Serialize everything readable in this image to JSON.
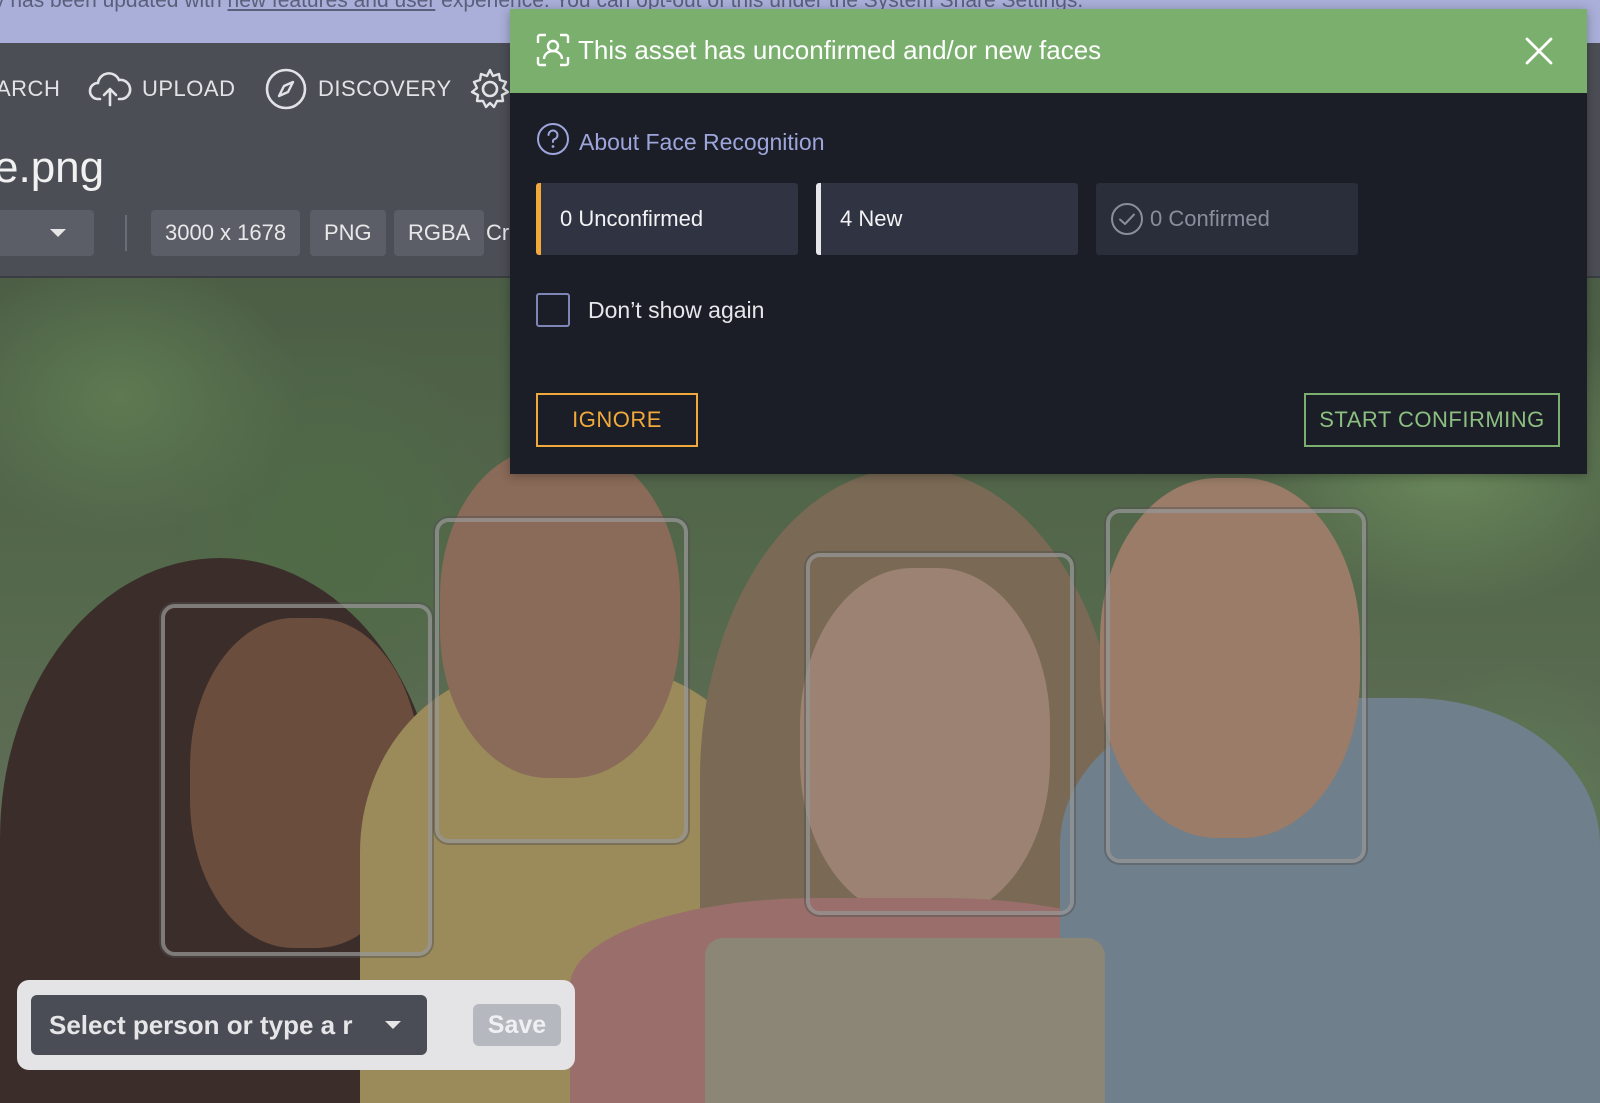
{
  "notice": {
    "text_before": "y has been updated with ",
    "link": "new features and user",
    "text_after": " experience. You can opt-out of this under the System Share Settings."
  },
  "nav": {
    "search": "ARCH",
    "upload": "UPLOAD",
    "discovery": "DISCOVERY"
  },
  "asset": {
    "filename": "e.png",
    "dimensions": "3000 x 1678",
    "format": "PNG",
    "color_mode": "RGBA",
    "truncated_chip": "Cr"
  },
  "dialog": {
    "title": "This asset has unconfirmed and/or new faces",
    "about_link": "About Face Recognition",
    "stats": {
      "unconfirmed": "0 Unconfirmed",
      "new": "4 New",
      "confirmed": "0 Confirmed"
    },
    "dont_show_again": "Don’t show again",
    "ignore_label": "IGNORE",
    "start_confirming_label": "START CONFIRMING"
  },
  "selector": {
    "placeholder": "Select person or type a r",
    "save_label": "Save"
  },
  "colors": {
    "header_green": "#7aaf6e",
    "accent_orange": "#f2a93b",
    "link_purple": "#9da5db",
    "dialog_bg": "#1b1e27"
  },
  "icons": [
    "upload-cloud-icon",
    "compass-icon",
    "gear-icon",
    "face-scan-icon",
    "close-icon",
    "help-circle-icon",
    "check-circle-icon",
    "chevron-down-icon"
  ]
}
